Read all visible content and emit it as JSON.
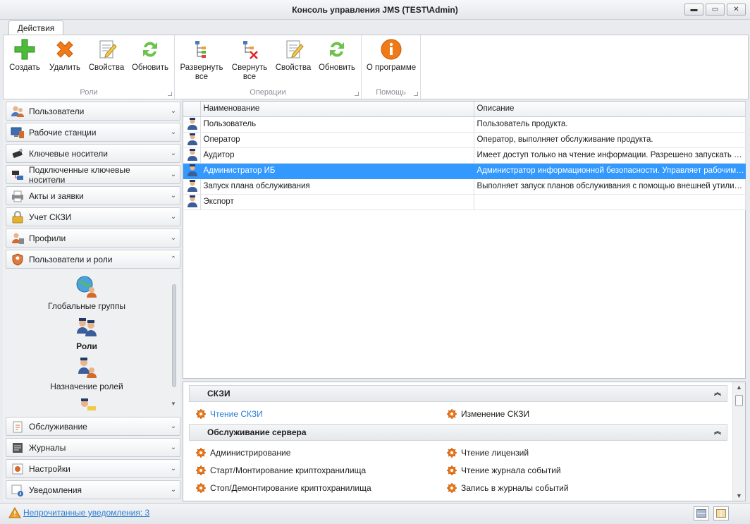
{
  "window": {
    "title": "Консоль управления JMS (TEST\\Admin)"
  },
  "ribbon": {
    "tab": "Действия",
    "groups": [
      {
        "label": "Роли",
        "buttons": [
          {
            "label": "Создать",
            "icon": "plus-icon"
          },
          {
            "label": "Удалить",
            "icon": "x-icon"
          },
          {
            "label": "Свойства",
            "icon": "properties-icon"
          },
          {
            "label": "Обновить",
            "icon": "refresh-icon"
          }
        ]
      },
      {
        "label": "Операции",
        "buttons": [
          {
            "label": "Развернуть",
            "label2": "все",
            "icon": "expand-tree-icon"
          },
          {
            "label": "Свернуть",
            "label2": "все",
            "icon": "collapse-tree-icon"
          },
          {
            "label": "Свойства",
            "icon": "properties-icon"
          },
          {
            "label": "Обновить",
            "icon": "refresh-icon"
          }
        ]
      },
      {
        "label": "Помощь",
        "buttons": [
          {
            "label": "О программе",
            "icon": "info-icon"
          }
        ]
      }
    ]
  },
  "nav": {
    "items_top": [
      {
        "label": "Пользователи",
        "icon": "users-icon"
      },
      {
        "label": "Рабочие станции",
        "icon": "workstation-icon"
      },
      {
        "label": "Ключевые носители",
        "icon": "usb-token-icon"
      },
      {
        "label": "Подключенные ключевые носители",
        "icon": "connected-token-icon"
      },
      {
        "label": "Акты и заявки",
        "icon": "printer-icon"
      },
      {
        "label": "Учет СКЗИ",
        "icon": "lock-icon"
      },
      {
        "label": "Профили",
        "icon": "profile-icon"
      },
      {
        "label": "Пользователи и роли",
        "icon": "shield-user-icon"
      }
    ],
    "sub_items": [
      {
        "label": "Глобальные группы",
        "icon": "global-groups-icon"
      },
      {
        "label": "Роли",
        "icon": "roles-icon"
      },
      {
        "label": "Назначение ролей",
        "icon": "role-assignment-icon"
      }
    ],
    "items_bottom": [
      {
        "label": "Обслуживание",
        "icon": "maintenance-icon"
      },
      {
        "label": "Журналы",
        "icon": "journal-icon"
      },
      {
        "label": "Настройки",
        "icon": "settings-icon"
      },
      {
        "label": "Уведомления",
        "icon": "notification-icon"
      }
    ]
  },
  "grid": {
    "columns": [
      "Наименование",
      "Описание"
    ],
    "rows": [
      {
        "name": "Пользователь",
        "desc": "Пользователь продукта."
      },
      {
        "name": "Оператор",
        "desc": "Оператор, выполняет обслуживание продукта."
      },
      {
        "name": "Аудитор",
        "desc": "Имеет доступ только на чтение информации. Разрешено запускать адм..."
      },
      {
        "name": "Администратор ИБ",
        "desc": "Администратор информационной безопасности. Управляет рабочими ст...",
        "selected": true
      },
      {
        "name": "Запуск плана обслуживания",
        "desc": "Выполняет запуск планов обслуживания с помощью внешней утилиты."
      },
      {
        "name": "Экспорт",
        "desc": ""
      }
    ]
  },
  "permissions": {
    "sections": [
      {
        "title": "СКЗИ",
        "items": [
          "Чтение СКЗИ",
          "Изменение СКЗИ"
        ]
      },
      {
        "title": "Обслуживание сервера",
        "items": [
          "Администрирование",
          "Чтение лицензий",
          "Старт/Монтирование криптохранилища",
          "Чтение журнала событий",
          "Стоп/Демонтирование криптохранилища",
          "Запись в журналы событий"
        ]
      }
    ]
  },
  "status": {
    "message": "Непрочитанные уведомления: 3"
  },
  "colors": {
    "selection": "#3399ff",
    "link": "#2a7fd4",
    "accent_orange": "#f07a18",
    "accent_green": "#4dbb3a"
  }
}
